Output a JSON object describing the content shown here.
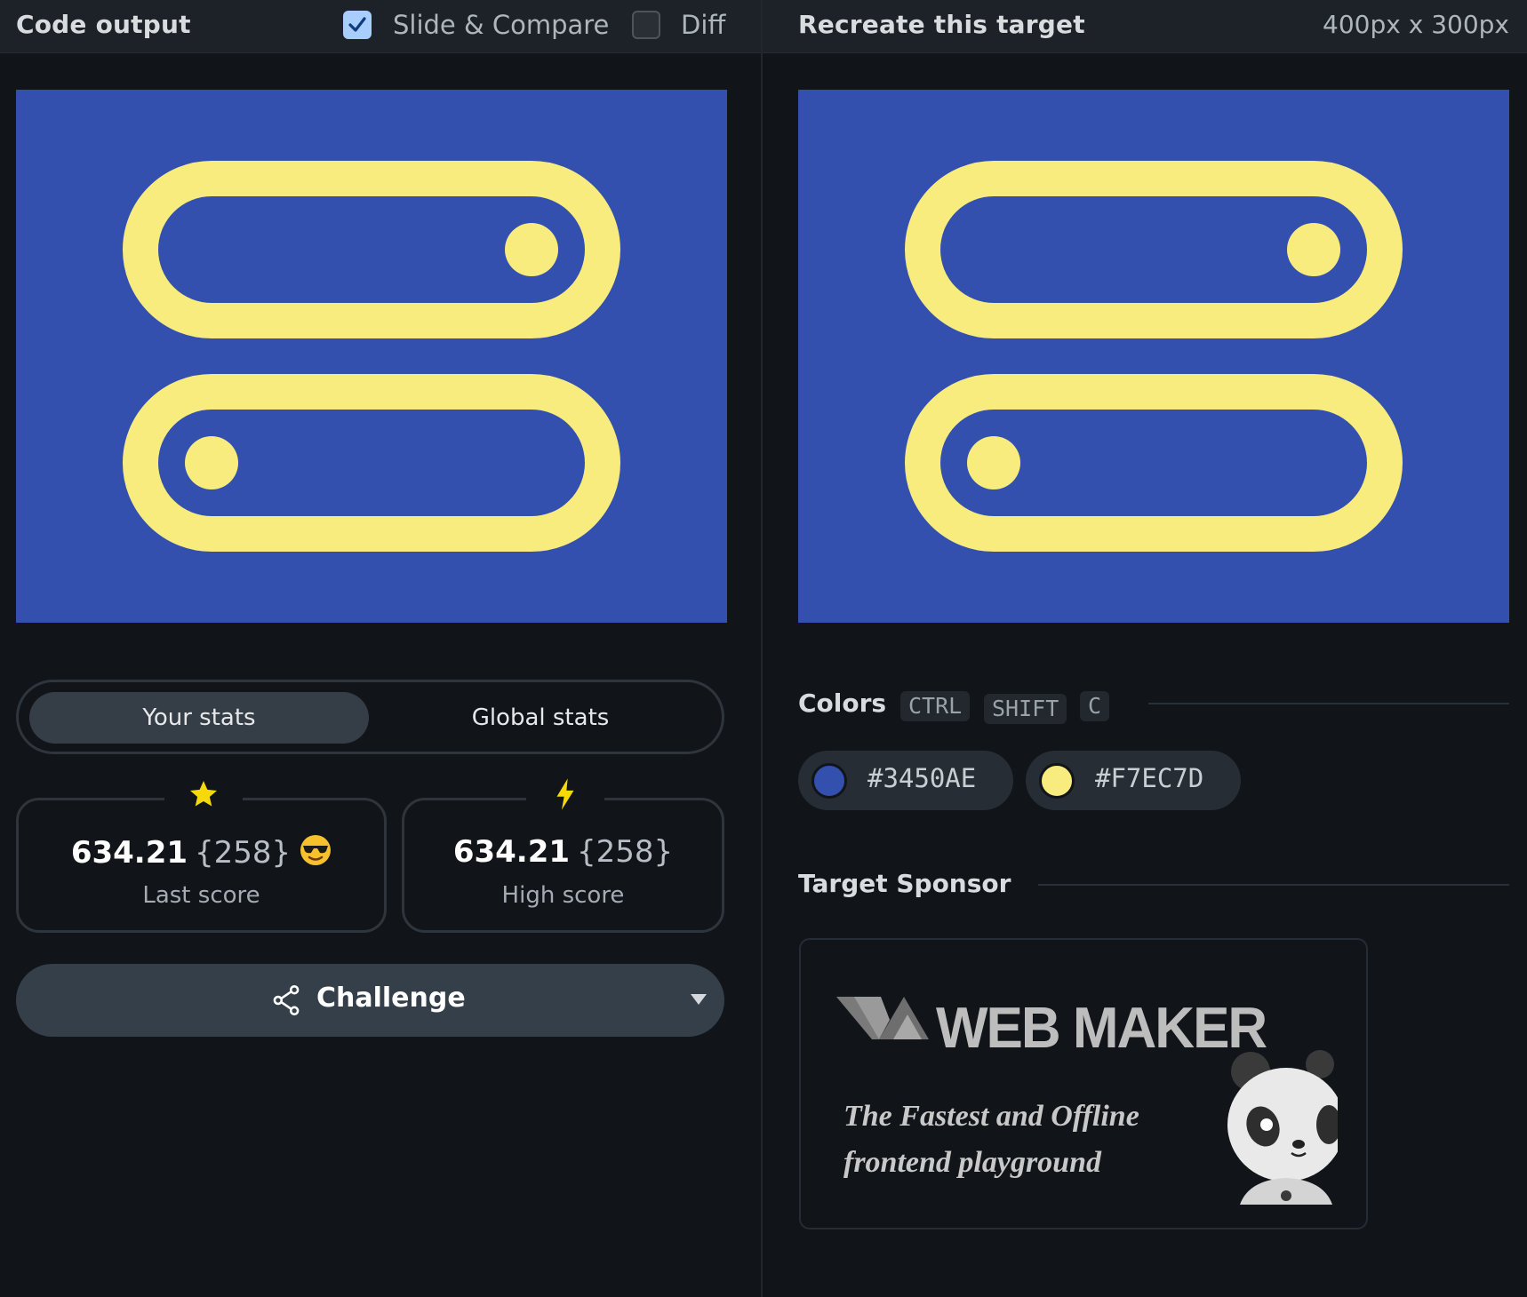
{
  "left_header": {
    "title": "Code output",
    "slide_compare": {
      "label": "Slide & Compare",
      "checked": true
    },
    "diff": {
      "label": "Diff",
      "checked": false
    }
  },
  "right_header": {
    "title": "Recreate this target",
    "size": "400px x 300px"
  },
  "colors": {
    "background": "#3450AE",
    "accent": "#F7EC7D"
  },
  "stats_tabs": {
    "active": "Your stats",
    "inactive": "Global stats"
  },
  "stats": {
    "last": {
      "score": "634.21",
      "count": "{258}",
      "label": "Last score",
      "icon": "star-icon",
      "badge": "sunglasses-emoji-icon"
    },
    "high": {
      "score": "634.21",
      "count": "{258}",
      "label": "High score",
      "icon": "lightning-icon"
    }
  },
  "challenge": {
    "label": "Challenge",
    "icon": "share-icon"
  },
  "colors_section": {
    "title": "Colors",
    "shortcut": [
      "CTRL",
      "SHIFT",
      "C"
    ],
    "swatches": [
      "#3450AE",
      "#F7EC7D"
    ]
  },
  "sponsor": {
    "title": "Target Sponsor",
    "brand": "WEB MAKER",
    "tagline_line1": "The Fastest and Offline",
    "tagline_line2": "frontend playground"
  }
}
